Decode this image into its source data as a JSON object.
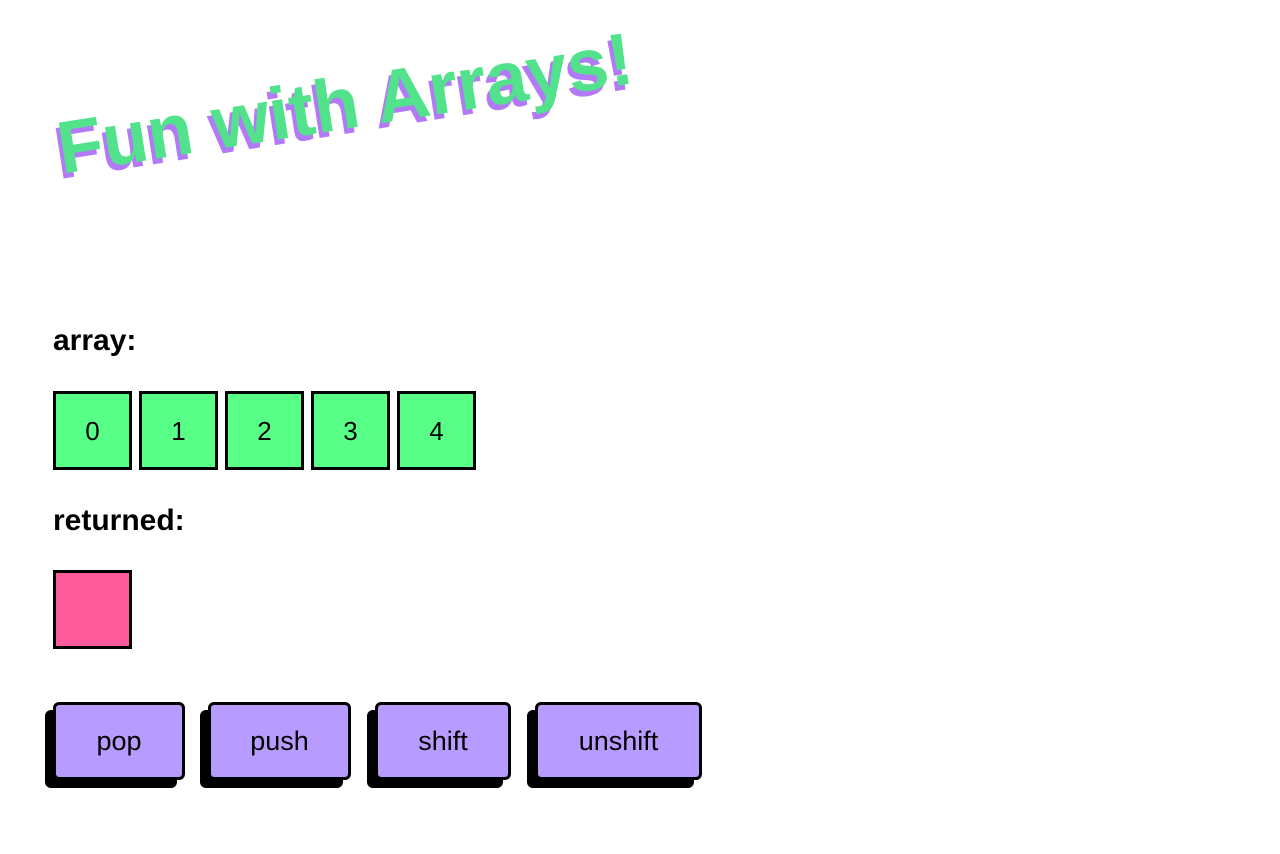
{
  "title": "Fun with Arrays!",
  "labels": {
    "array": "array:",
    "returned": "returned:"
  },
  "array": [
    "0",
    "1",
    "2",
    "3",
    "4"
  ],
  "returned": [
    ""
  ],
  "buttons": {
    "pop": "pop",
    "push": "push",
    "shift": "shift",
    "unshift": "unshift"
  },
  "colors": {
    "title_fill": "#52e28c",
    "title_shadow": "#b27af6",
    "array_cell": "#58ff86",
    "returned_cell": "#ff5b9a",
    "button": "#b89bfe",
    "border": "#000000"
  }
}
